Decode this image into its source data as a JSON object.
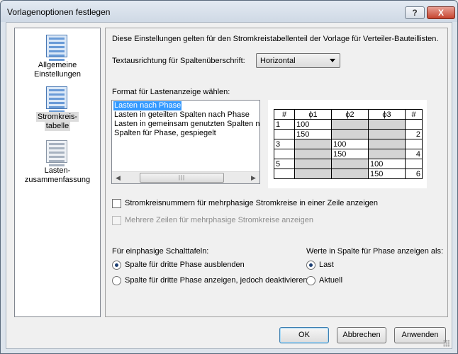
{
  "window": {
    "title": "Vorlagenoptionen festlegen",
    "help_label": "?",
    "close_label": "X"
  },
  "nav": {
    "items": [
      {
        "label_line1": "Allgemeine",
        "label_line2": "Einstellungen",
        "icon": "table-grid-icon"
      },
      {
        "label_line1": "Stromkreis-",
        "label_line2": "tabelle",
        "icon": "table-grid-icon",
        "selected": true
      },
      {
        "label_line1": "Lasten-",
        "label_line2": "zusammenfassung",
        "icon": "table-grid-icon"
      }
    ]
  },
  "content": {
    "description": "Diese Einstellungen gelten für den Stromkreistabellenteil der Vorlage für Verteiler-Bauteillisten.",
    "text_direction_label": "Textausrichtung für Spaltenüberschrift:",
    "text_direction_value": "Horizontal",
    "format_label": "Format für Lastenanzeige wählen:",
    "format_options": [
      "Lasten nach Phase",
      "Lasten in geteilten Spalten nach Phase",
      "Lasten in gemeinsam genutzten Spalten nach Phase",
      "Spalten für Phase, gespiegelt"
    ],
    "format_selected_index": 0,
    "scroll_left": "◀",
    "scroll_right": "▶",
    "scroll_thumb": "|||",
    "preview": {
      "headers": [
        "#",
        "ϕ1",
        "ϕ2",
        "ϕ3",
        "#"
      ],
      "rows": [
        [
          "1",
          "100",
          "",
          "",
          ""
        ],
        [
          "",
          "150",
          "",
          "",
          "2"
        ],
        [
          "3",
          "",
          "100",
          "",
          ""
        ],
        [
          "",
          "",
          "150",
          "",
          "4"
        ],
        [
          "5",
          "",
          "",
          "100",
          ""
        ],
        [
          "",
          "",
          "",
          "150",
          "6"
        ]
      ]
    },
    "checkbox_one_row": "Stromkreisnummern für mehrphasige Stromkreise in einer Zeile anzeigen",
    "checkbox_one_row_checked": false,
    "checkbox_multi_rows": "Mehrere Zeilen für mehrphasige Stromkreise anzeigen",
    "checkbox_multi_rows_enabled": false,
    "single_phase_label": "Für einphasige Schalttafeln:",
    "single_phase_options": [
      "Spalte für dritte Phase ausblenden",
      "Spalte für dritte Phase anzeigen, jedoch deaktivieren"
    ],
    "single_phase_selected": 0,
    "values_label": "Werte in Spalte für Phase anzeigen als:",
    "values_options": [
      "Last",
      "Aktuell"
    ],
    "values_selected": 0
  },
  "buttons": {
    "ok": "OK",
    "cancel": "Abbrechen",
    "apply": "Anwenden"
  }
}
